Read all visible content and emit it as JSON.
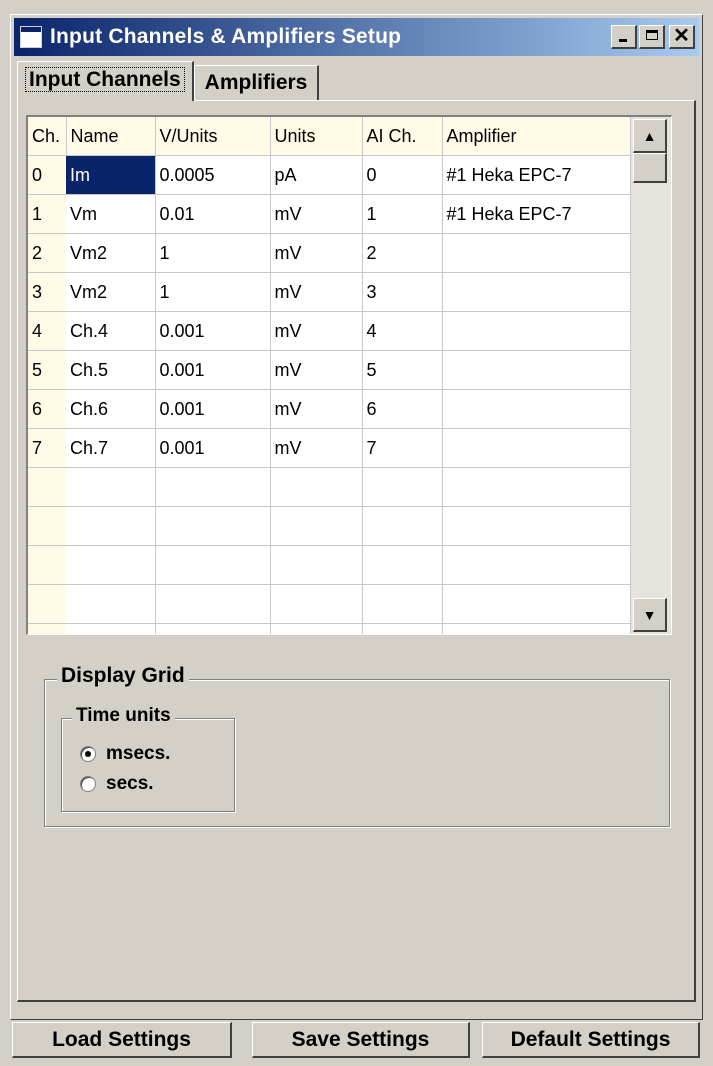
{
  "window": {
    "title": "Input Channels & Amplifiers Setup",
    "minimize_label": "_",
    "maximize_label": "□",
    "close_label": "✕"
  },
  "tabs": [
    {
      "label": "Input Channels",
      "active": true
    },
    {
      "label": "Amplifiers",
      "active": false
    }
  ],
  "grid": {
    "columns": [
      "Ch.",
      "Name",
      "V/Units",
      "Units",
      "AI Ch.",
      "Amplifier"
    ],
    "rows": [
      [
        "0",
        "Im",
        "0.0005",
        "pA",
        "0",
        "#1 Heka EPC-7"
      ],
      [
        "1",
        "Vm",
        "0.01",
        "mV",
        "1",
        "#1 Heka EPC-7"
      ],
      [
        "2",
        "Vm2",
        "1",
        "mV",
        "2",
        ""
      ],
      [
        "3",
        "Vm2",
        "1",
        "mV",
        "3",
        ""
      ],
      [
        "4",
        "Ch.4",
        "0.001",
        "mV",
        "4",
        ""
      ],
      [
        "5",
        "Ch.5",
        "0.001",
        "mV",
        "5",
        ""
      ],
      [
        "6",
        "Ch.6",
        "0.001",
        "mV",
        "6",
        ""
      ],
      [
        "7",
        "Ch.7",
        "0.001",
        "mV",
        "7",
        ""
      ]
    ],
    "selected_cell": {
      "row": 0,
      "col": 1
    }
  },
  "display_grid": {
    "legend": "Display Grid",
    "time_units": {
      "legend": "Time units",
      "options": [
        {
          "label": "msecs.",
          "selected": true
        },
        {
          "label": "secs.",
          "selected": false
        }
      ]
    }
  },
  "buttons": {
    "load": "Load Settings",
    "save": "Save Settings",
    "default": "Default Settings"
  },
  "colors": {
    "face": "#d4d0c8",
    "title_start": "#0a246a",
    "title_end": "#a6caf0",
    "header_bg": "#fffbe6",
    "selection": "#0a246a"
  }
}
